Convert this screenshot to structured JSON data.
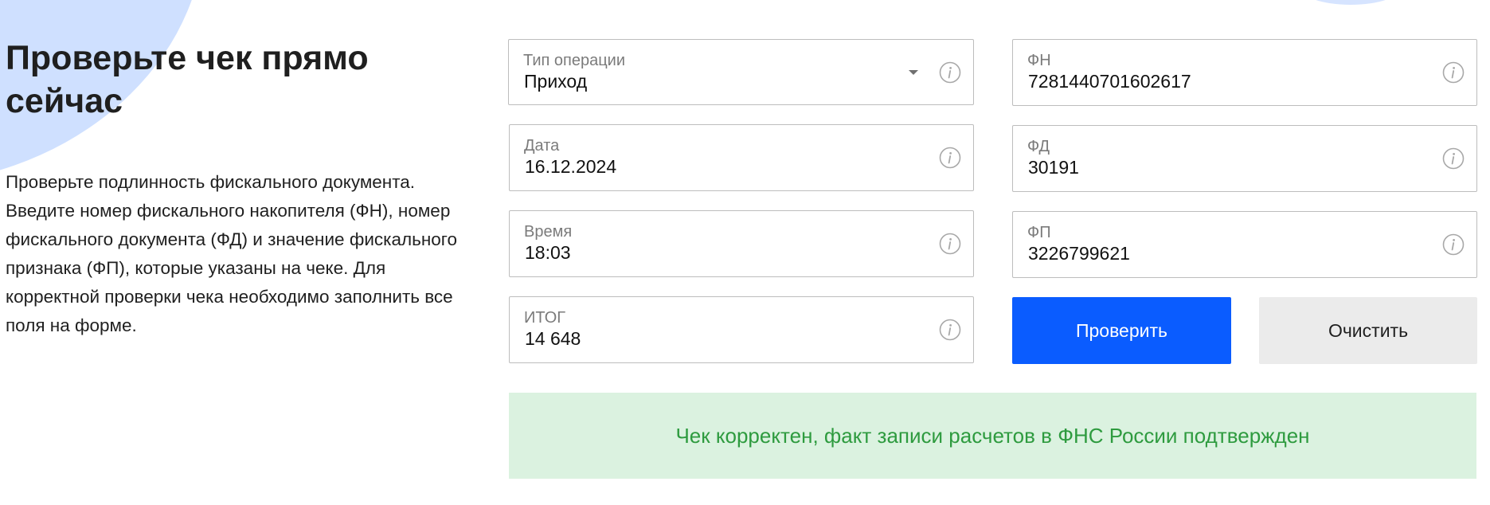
{
  "hero": {
    "title": "Проверьте чек прямо сейчас",
    "description": "Проверьте подлинность фискального документа. Введите номер фискального накопителя (ФН), номер фискального документа (ФД) и значение фискального признака (ФП), которые указаны на чеке. Для корректной проверки чека необходимо заполнить все поля на форме."
  },
  "form": {
    "operation_type": {
      "label": "Тип операции",
      "value": "Приход"
    },
    "date": {
      "label": "Дата",
      "value": "16.12.2024"
    },
    "time": {
      "label": "Время",
      "value": "18:03"
    },
    "total": {
      "label": "ИТОГ",
      "value": "14 648"
    },
    "fn": {
      "label": "ФН",
      "value": "7281440701602617"
    },
    "fd": {
      "label": "ФД",
      "value": "30191"
    },
    "fp": {
      "label": "ФП",
      "value": "3226799621"
    },
    "check_button": "Проверить",
    "clear_button": "Очистить"
  },
  "result": {
    "message": "Чек корректен, факт записи расчетов в ФНС России подтвержден"
  },
  "icons": {
    "field_info": "info-icon",
    "dropdown": "chevron-down-icon"
  },
  "colors": {
    "primary": "#0a5cff",
    "secondary_button": "#ebebeb",
    "success_bg": "#dbf2e0",
    "success_text": "#2e9b3f",
    "field_border": "#bdbdbd",
    "decoration": "#cfe0ff"
  }
}
